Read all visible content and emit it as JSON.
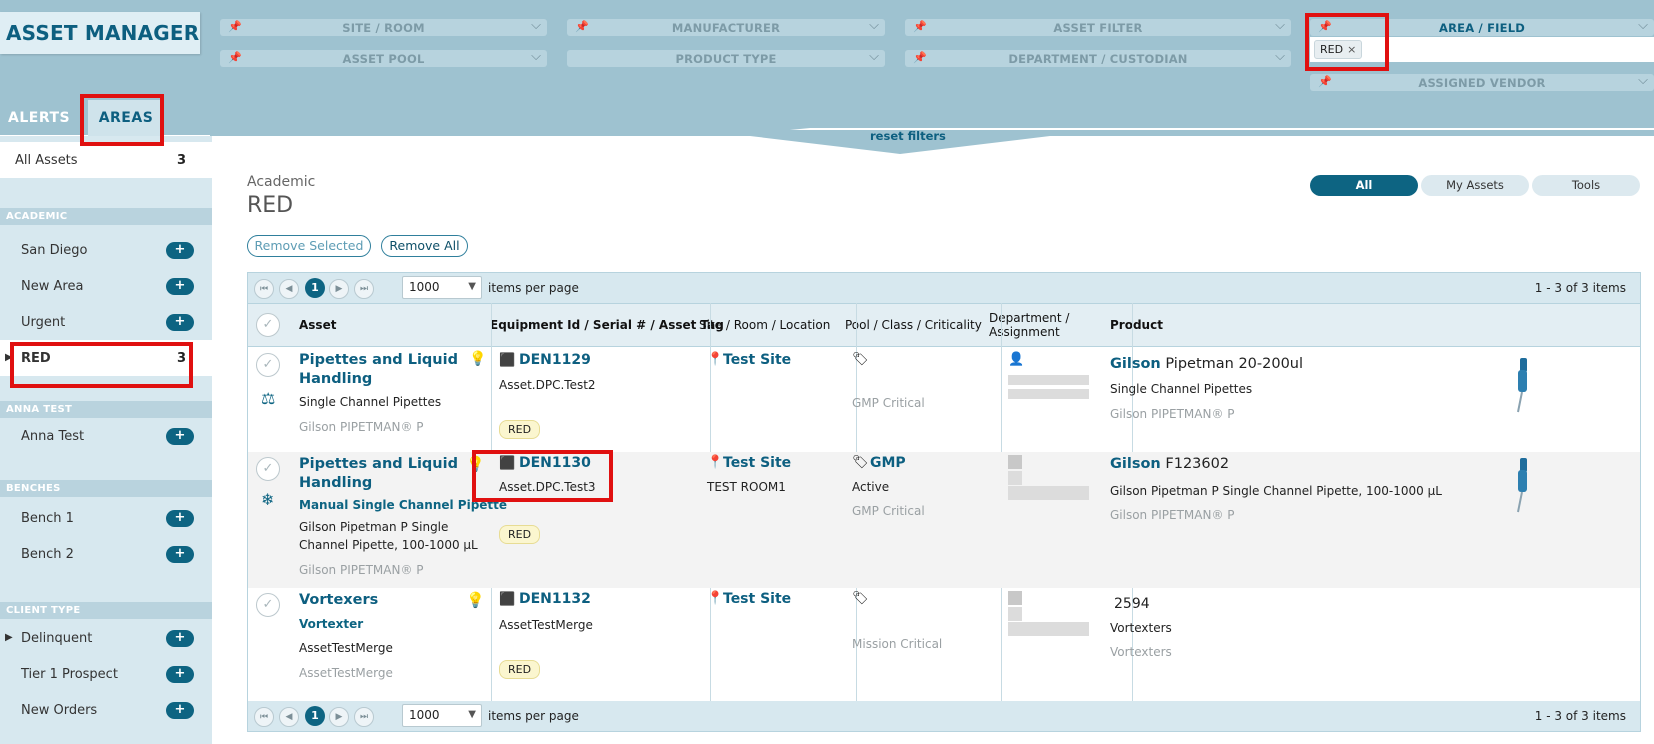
{
  "app": {
    "title": "ASSET MANAGER"
  },
  "filters": {
    "site_room": "SITE / ROOM",
    "manufacturer": "MANUFACTURER",
    "asset_filter": "ASSET FILTER",
    "area_field": "AREA / FIELD",
    "asset_pool": "ASSET POOL",
    "product_type": "PRODUCT TYPE",
    "department": "DEPARTMENT / CUSTODIAN",
    "assigned_vendor": "ASSIGNED VENDOR",
    "area_chip": "RED",
    "chip_remove": "×",
    "reset": "reset filters",
    "pin_icon": "pin-icon",
    "chevron_icon": "chevron-down-icon"
  },
  "tabs": {
    "alerts": "ALERTS",
    "areas": "AREAS"
  },
  "sidebar": {
    "all_assets": {
      "label": "All Assets",
      "count": "3"
    },
    "sections": {
      "academic": "ACADEMIC",
      "anna_test": "ANNA TEST",
      "benches": "BENCHES",
      "client_type": "CLIENT TYPE"
    },
    "items": {
      "san_diego": "San Diego",
      "new_area": "New Area",
      "urgent": "Urgent",
      "red": {
        "label": "RED",
        "count": "3"
      },
      "anna_test": "Anna Test",
      "bench1": "Bench 1",
      "bench2": "Bench 2",
      "delinquent": "Delinquent",
      "tier1": "Tier 1 Prospect",
      "new_orders": "New Orders"
    },
    "plus": "+"
  },
  "main": {
    "breadcrumb": "Academic",
    "title": "RED",
    "segments": {
      "all": "All",
      "my": "My Assets",
      "tools": "Tools"
    },
    "remove_selected": "Remove Selected",
    "remove_all": "Remove All"
  },
  "pager": {
    "current_page": "1",
    "per_page": "1000",
    "items_per_page": "items per page",
    "range": "1 - 3 of 3 items",
    "first": "⏮",
    "prev": "◀",
    "next": "▶",
    "last": "⏭",
    "caret": "▼"
  },
  "columns": {
    "asset": "Asset",
    "equipment": "Equipment Id / Serial # / Asset Tag",
    "site": "Site / Room / Location",
    "pool": "Pool / Class / Criticality",
    "dept_line1": "Department /",
    "dept_line2": "Assignment",
    "product": "Product"
  },
  "rows": [
    {
      "asset_name": "Pipettes and Liquid Handling",
      "asset_type": "Single Channel Pipettes",
      "asset_model": "Gilson PIPETMAN® P",
      "equipment_id": "DEN1129",
      "serial": "Asset.DPC.Test2",
      "tag": "RED",
      "site": "Test Site",
      "criticality": "GMP Critical",
      "product_brand": "Gilson",
      "product_model": "Pipetman 20-200ul",
      "product_desc": "Single Channel Pipettes",
      "product_line": "Gilson PIPETMAN® P",
      "icon_left": "scale-icon",
      "icon_right": "lightbulb-dollar-icon"
    },
    {
      "asset_name": "Pipettes and Liquid Handling",
      "asset_sub": "Manual Single Channel Pipette",
      "asset_type": "Gilson Pipetman P Single Channel Pipette, 100-1000 µL",
      "asset_model": "Gilson PIPETMAN® P",
      "equipment_id": "DEN1130",
      "serial": "Asset.DPC.Test3",
      "tag": "RED",
      "site": "Test Site",
      "room": "TEST ROOM1",
      "pool": "GMP",
      "status": "Active",
      "criticality": "GMP Critical",
      "product_brand": "Gilson",
      "product_model": "F123602",
      "product_desc": "Gilson Pipetman P Single Channel Pipette, 100-1000 µL",
      "product_line": "Gilson PIPETMAN® P",
      "icon_left": "snowflake-icon",
      "icon_right": "lightbulb-icon"
    },
    {
      "asset_name": "Vortexers",
      "asset_sub": "Vortexter",
      "asset_type": "AssetTestMerge",
      "asset_model": "AssetTestMerge",
      "equipment_id": "DEN1132",
      "serial": "AssetTestMerge",
      "tag": "RED",
      "site": "Test Site",
      "criticality": "Mission Critical",
      "product_model": "2594",
      "product_desc": "Vortexters",
      "product_line": "Vortexters",
      "icon_right": "lightbulb-icon"
    }
  ],
  "colors": {
    "brand": "#0d5f80",
    "header_bg": "#9ec2d0",
    "sidebar_bg": "#d7e8ef",
    "highlight": "#e01010",
    "tag_bg": "#fbf6cf"
  }
}
